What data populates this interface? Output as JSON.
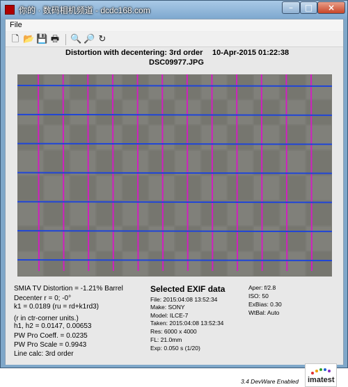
{
  "window": {
    "title": "你的 · 数码相机频道 - dcdc168.com",
    "minimize": "–",
    "maximize": "□",
    "close": "×"
  },
  "menu": {
    "file": "File"
  },
  "toolbar": {
    "icons": [
      "new-icon",
      "open-icon",
      "save-icon",
      "print-icon",
      "zoom-in-icon",
      "zoom-out-icon",
      "rotate-icon"
    ]
  },
  "plot": {
    "title": "Distortion with decentering:  3rd order",
    "date": "10-Apr-2015 01:22:38",
    "file": "DSC09977.JPG"
  },
  "chart_data": {
    "type": "scatter",
    "vertical_lines": 12,
    "horizontal_lines": 7,
    "colors": {
      "vertical": "#d020c0",
      "horizontal": "#1f45d8",
      "background": "#7a7a74"
    }
  },
  "results": {
    "smia": "SMIA TV Distortion = -1.21% Barrel",
    "decenter": "Decenter r = 0;  -0°",
    "k1": "k1 = 0.0189  (ru = rd+k1rd3)",
    "note": "(r in ctr-corner units.)",
    "h": "h1, h2 = 0.0147, 0.00653",
    "pw_coeff": "PW Pro Coeff. = 0.0235",
    "pw_scale": "PW Pro Scale = 0.9943",
    "line_calc": "Line calc: 3rd order"
  },
  "exif": {
    "title": "Selected EXIF data",
    "file": "File:  2015:04:08 13:52:34",
    "make": "Make:  SONY",
    "model": "Model: ILCE-7",
    "taken": "Taken: 2015:04:08 13:52:34",
    "res": "Res:   6000 x 4000",
    "fl": "FL:  21.0mm",
    "exp": "Exp:  0.050 s  (1/20)"
  },
  "camera": {
    "aper": "Aper:  f/2.8",
    "iso": "ISO:   50",
    "exbias": "ExBias: 0.30",
    "wtbal": "WtBal: Auto"
  },
  "branding": {
    "version": "3.4  DevWare Enabled",
    "logo": "imatest"
  }
}
